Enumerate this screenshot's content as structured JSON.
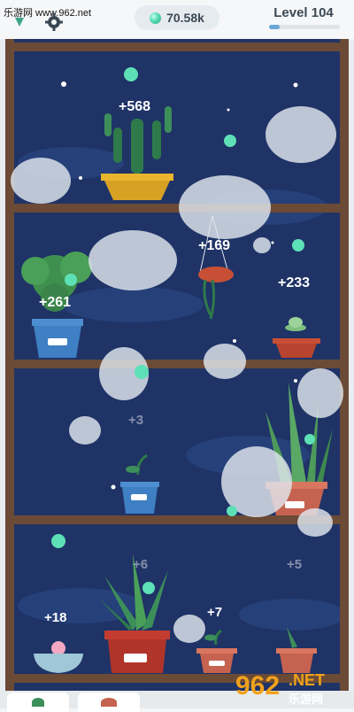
{
  "watermark_left": "乐游网 www.962.net",
  "currency": {
    "icon": "gem-icon",
    "value": "70.58k"
  },
  "level": {
    "label": "Level 104",
    "progress": 0.15
  },
  "plants": [
    {
      "name": "cactus",
      "reward": "+568"
    },
    {
      "name": "hanging-plant",
      "reward": "+169"
    },
    {
      "name": "succulent",
      "reward": "+233"
    },
    {
      "name": "fern",
      "reward": "+261"
    },
    {
      "name": "sprout-shelf3",
      "reward": "+3"
    },
    {
      "name": "snake-plant",
      "reward": ""
    },
    {
      "name": "aloe",
      "reward": "+6"
    },
    {
      "name": "small-sprout",
      "reward": "+7"
    },
    {
      "name": "bowl-succulent",
      "reward": "+18"
    },
    {
      "name": "corner-plant",
      "reward": "+5"
    }
  ],
  "watermark_badge": {
    "text1": "962",
    "text2": ".NET",
    "text3": "乐游网"
  },
  "colors": {
    "night": "#1f3366",
    "wood": "#6b4a36",
    "pot_red": "#c43c2f",
    "pot_blue": "#3f7fc3",
    "pot_yellow": "#e8b52c"
  }
}
